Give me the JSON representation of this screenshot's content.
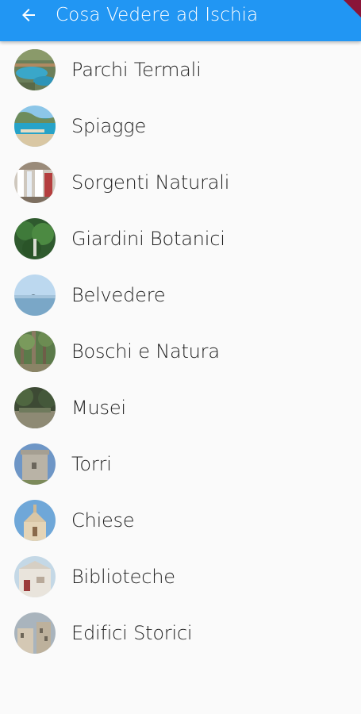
{
  "appbar": {
    "title": "Cosa Vedere ad Ischia",
    "back_icon": "arrow-back-icon",
    "color": "#2196f3"
  },
  "categories": [
    {
      "label": "Parchi Termali",
      "icon": "thermal-park-thumbnail"
    },
    {
      "label": "Spiagge",
      "icon": "beach-thumbnail"
    },
    {
      "label": "Sorgenti Naturali",
      "icon": "natural-spring-thumbnail"
    },
    {
      "label": "Giardini Botanici",
      "icon": "botanical-garden-thumbnail"
    },
    {
      "label": "Belvedere",
      "icon": "viewpoint-thumbnail"
    },
    {
      "label": "Boschi e Natura",
      "icon": "forest-thumbnail"
    },
    {
      "label": "Musei",
      "icon": "museum-thumbnail"
    },
    {
      "label": "Torri",
      "icon": "tower-thumbnail"
    },
    {
      "label": "Chiese",
      "icon": "church-thumbnail"
    },
    {
      "label": "Biblioteche",
      "icon": "library-thumbnail"
    },
    {
      "label": "Edifici Storici",
      "icon": "historic-building-thumbnail"
    }
  ]
}
